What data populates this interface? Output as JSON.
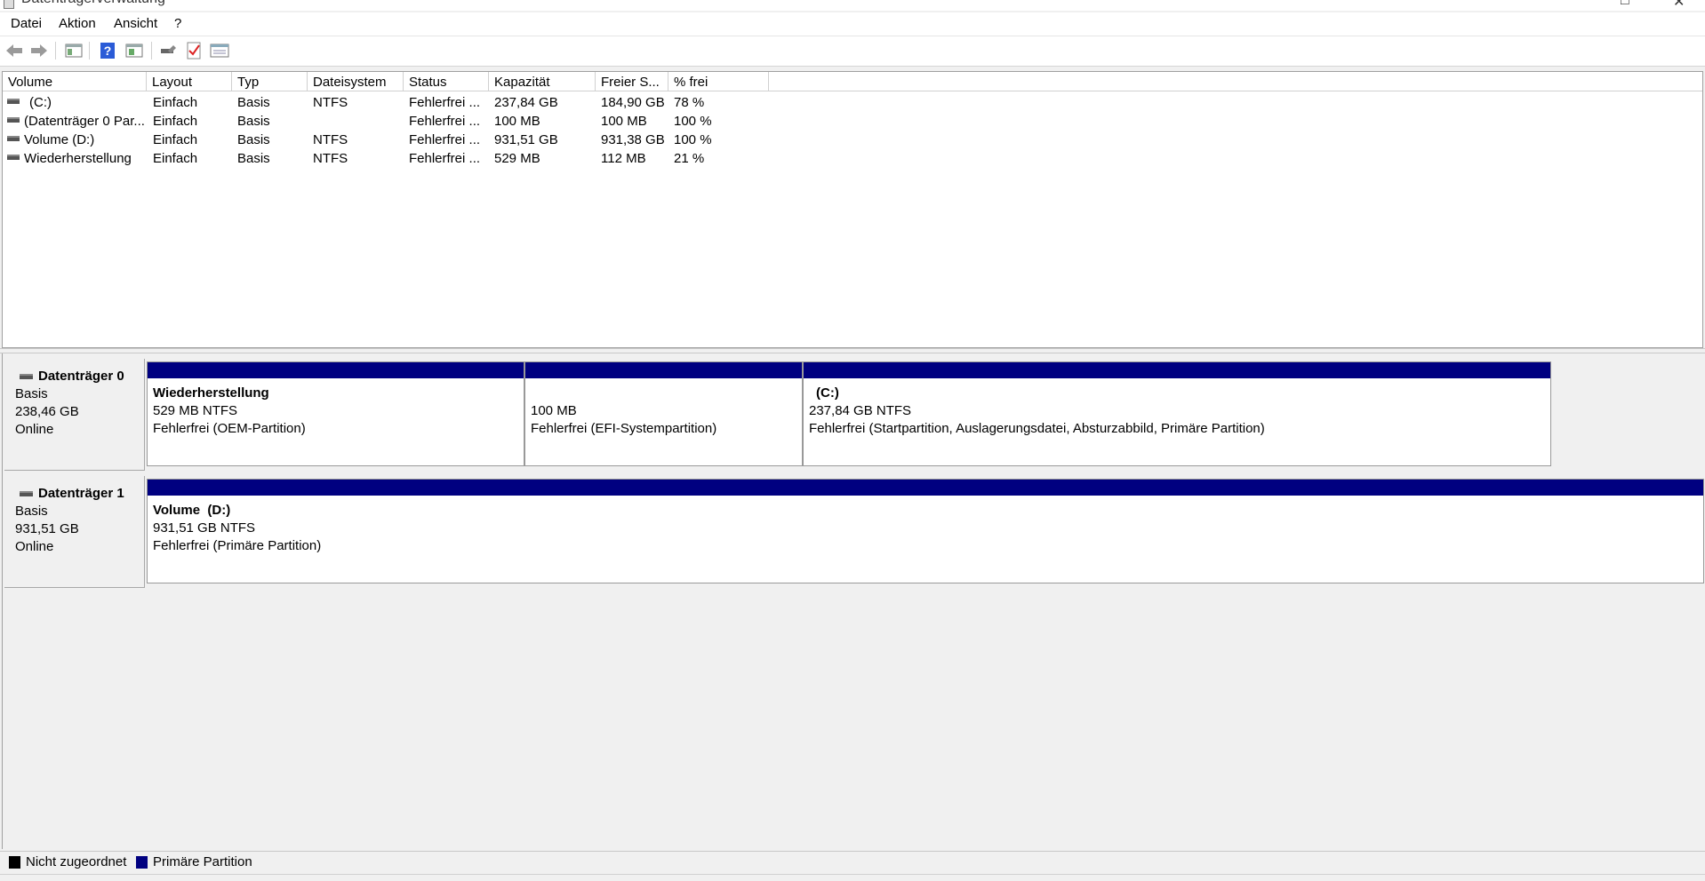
{
  "window": {
    "title": "Datenträgerverwaltung"
  },
  "menu": [
    "Datei",
    "Aktion",
    "Ansicht",
    "?"
  ],
  "toolbar": {
    "icons": [
      "back-arrow-icon",
      "forward-arrow-icon",
      "console-tree-icon",
      "help-icon",
      "action-pane-icon",
      "rescan-icon",
      "check-disk-icon",
      "properties-icon"
    ]
  },
  "volumes": {
    "columns": [
      "Volume",
      "Layout",
      "Typ",
      "Dateisystem",
      "Status",
      "Kapazität",
      "Freier S...",
      "% frei"
    ],
    "rows": [
      [
        "(C:)",
        "Einfach",
        "Basis",
        "NTFS",
        "Fehlerfrei ...",
        "237,84 GB",
        "184,90 GB",
        "78 %"
      ],
      [
        "(Datenträger 0 Par...",
        "Einfach",
        "Basis",
        "",
        "Fehlerfrei ...",
        "100 MB",
        "100 MB",
        "100 %"
      ],
      [
        "Volume (D:)",
        "Einfach",
        "Basis",
        "NTFS",
        "Fehlerfrei ...",
        "931,51 GB",
        "931,38 GB",
        "100 %"
      ],
      [
        "Wiederherstellung",
        "Einfach",
        "Basis",
        "NTFS",
        "Fehlerfrei ...",
        "529 MB",
        "112 MB",
        "21 %"
      ]
    ]
  },
  "disks": [
    {
      "name": "Datenträger 0",
      "type": "Basis",
      "size": "238,46 GB",
      "status": "Online",
      "partitions": [
        {
          "name": "Wiederherstellung",
          "size": "529 MB NTFS",
          "status": "Fehlerfrei (OEM-Partition)"
        },
        {
          "name": "",
          "size": "100 MB",
          "status": "Fehlerfrei (EFI-Systempartition)"
        },
        {
          "name": "(C:)",
          "size": "237,84 GB NTFS",
          "status": "Fehlerfrei (Startpartition, Auslagerungsdatei, Absturzabbild, Primäre Partition)"
        }
      ]
    },
    {
      "name": "Datenträger 1",
      "type": "Basis",
      "size": "931,51 GB",
      "status": "Online",
      "partitions": [
        {
          "name": "Volume  (D:)",
          "size": "931,51 GB NTFS",
          "status": "Fehlerfrei (Primäre Partition)"
        }
      ]
    }
  ],
  "legend": [
    {
      "label": "Nicht zugeordnet",
      "color": "#000000"
    },
    {
      "label": "Primäre Partition",
      "color": "#000080"
    }
  ],
  "colors": {
    "partition_bar": "#000080"
  }
}
